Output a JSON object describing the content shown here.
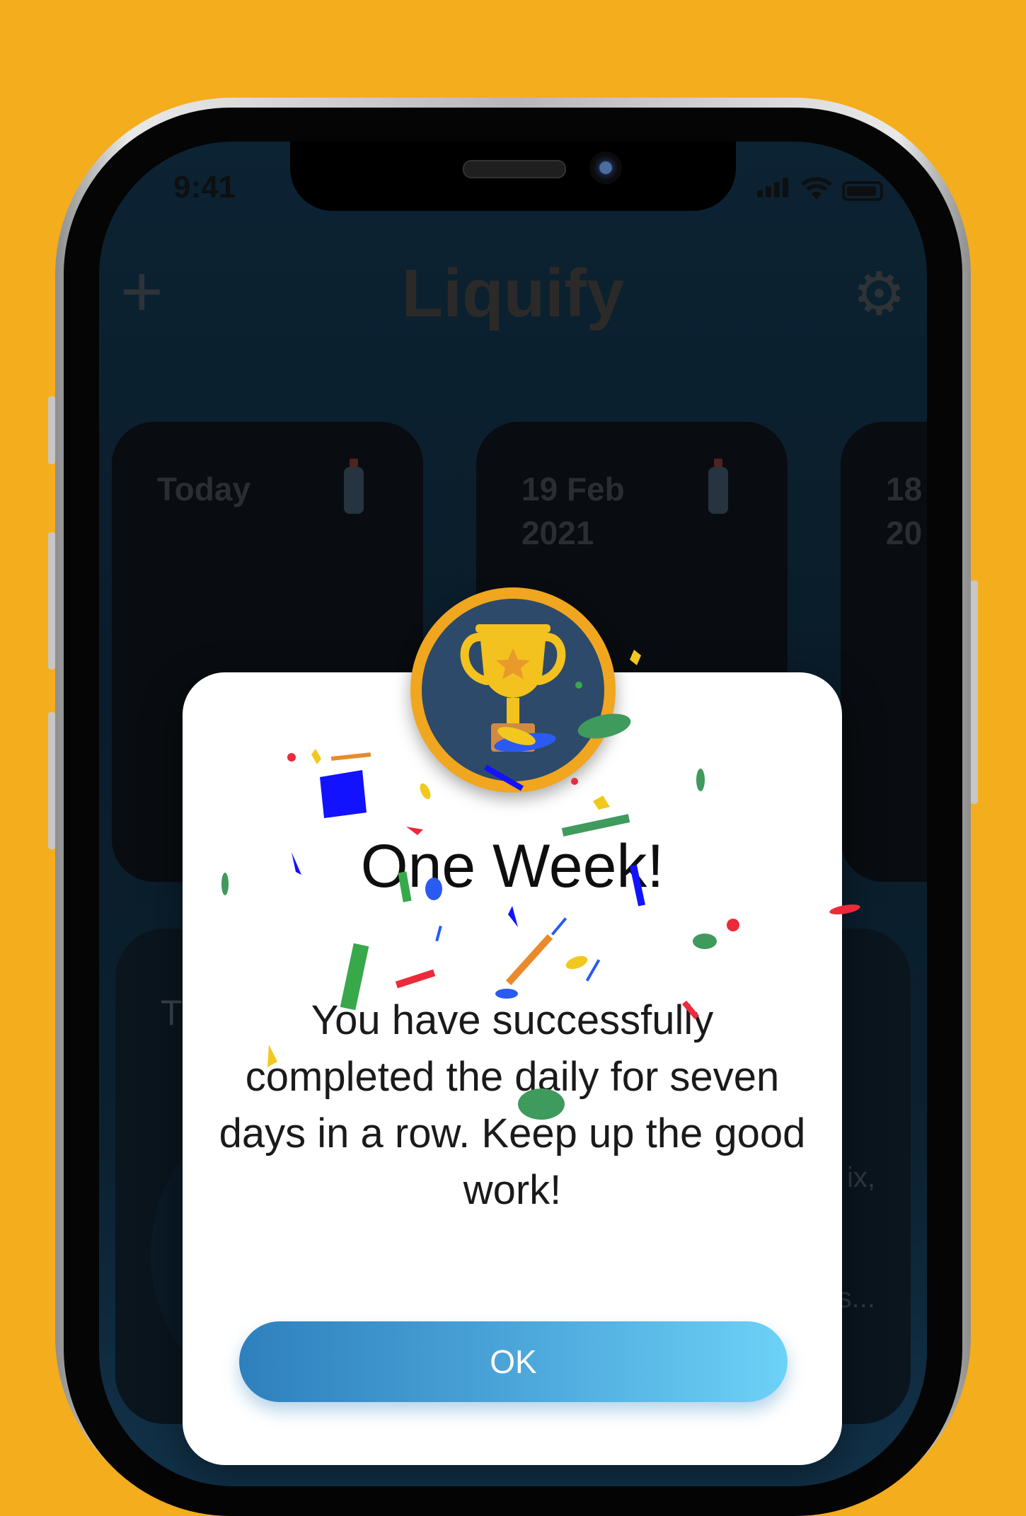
{
  "status_bar": {
    "time": "9:41"
  },
  "app": {
    "title": "Liquify",
    "add_icon": "plus-icon",
    "settings_icon": "gear-icon"
  },
  "cards": [
    {
      "label": "Today"
    },
    {
      "label": "19 Feb\n2021"
    },
    {
      "label": "18\n20"
    }
  ],
  "background_text": {
    "t": "T",
    "line_a": "ix,",
    "line_b": "s..."
  },
  "achievement": {
    "icon": "trophy-icon",
    "title": "One Week!",
    "message": "You have successfully completed the daily for seven days in a row. Keep up the good work!",
    "ok_label": "OK"
  },
  "colors": {
    "background": "#F4AD1C",
    "badge_ring": "#F1A61F",
    "badge_fill": "#2D4A6B",
    "button_start": "#2E80BD",
    "button_end": "#6DD2F7"
  }
}
